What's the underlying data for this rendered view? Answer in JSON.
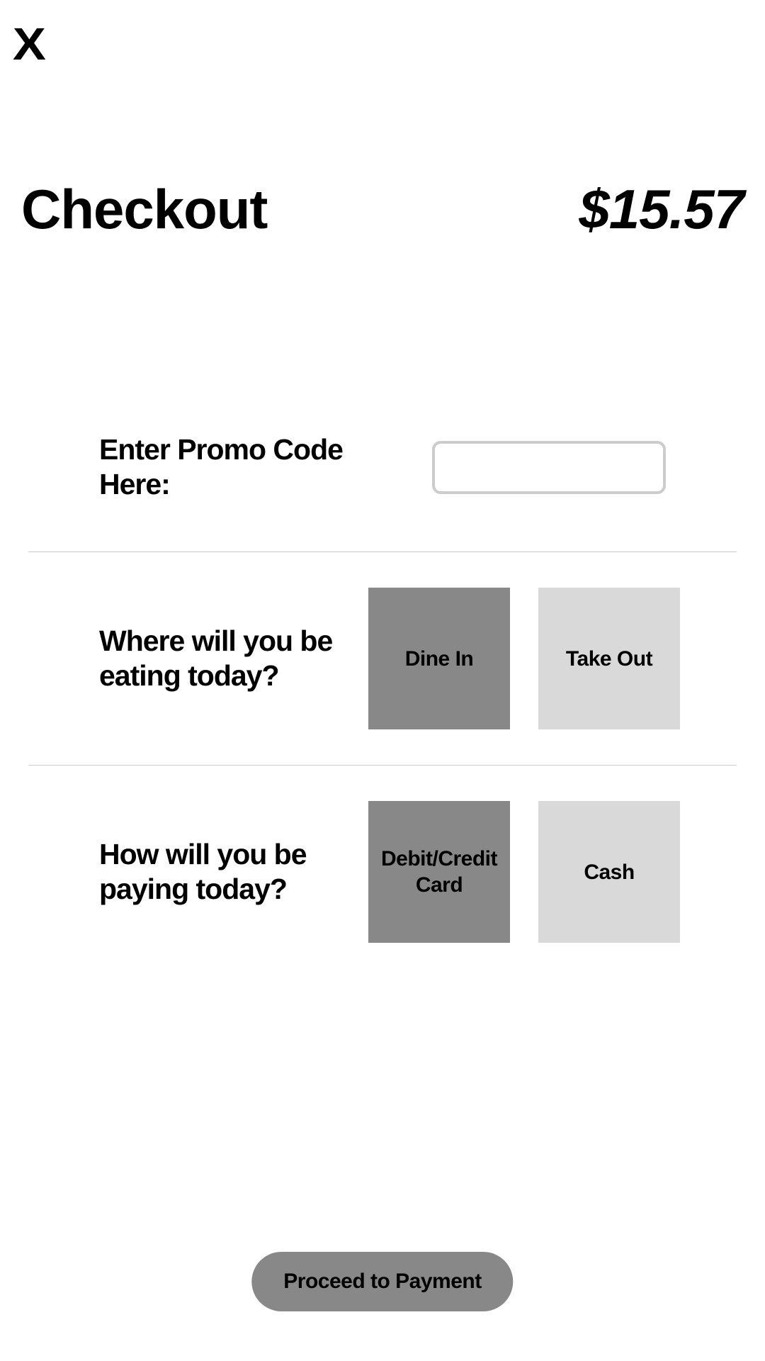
{
  "close_label": "X",
  "header": {
    "title": "Checkout",
    "total": "$15.57"
  },
  "promo": {
    "label": "Enter Promo Code Here:",
    "value": ""
  },
  "eating": {
    "label": "Where will you be eating today?",
    "options": [
      {
        "label": "Dine In",
        "selected": true
      },
      {
        "label": "Take Out",
        "selected": false
      }
    ]
  },
  "payment": {
    "label": "How will you be paying today?",
    "options": [
      {
        "label": "Debit/Credit Card",
        "selected": true
      },
      {
        "label": "Cash",
        "selected": false
      }
    ]
  },
  "proceed_label": "Proceed to Payment"
}
